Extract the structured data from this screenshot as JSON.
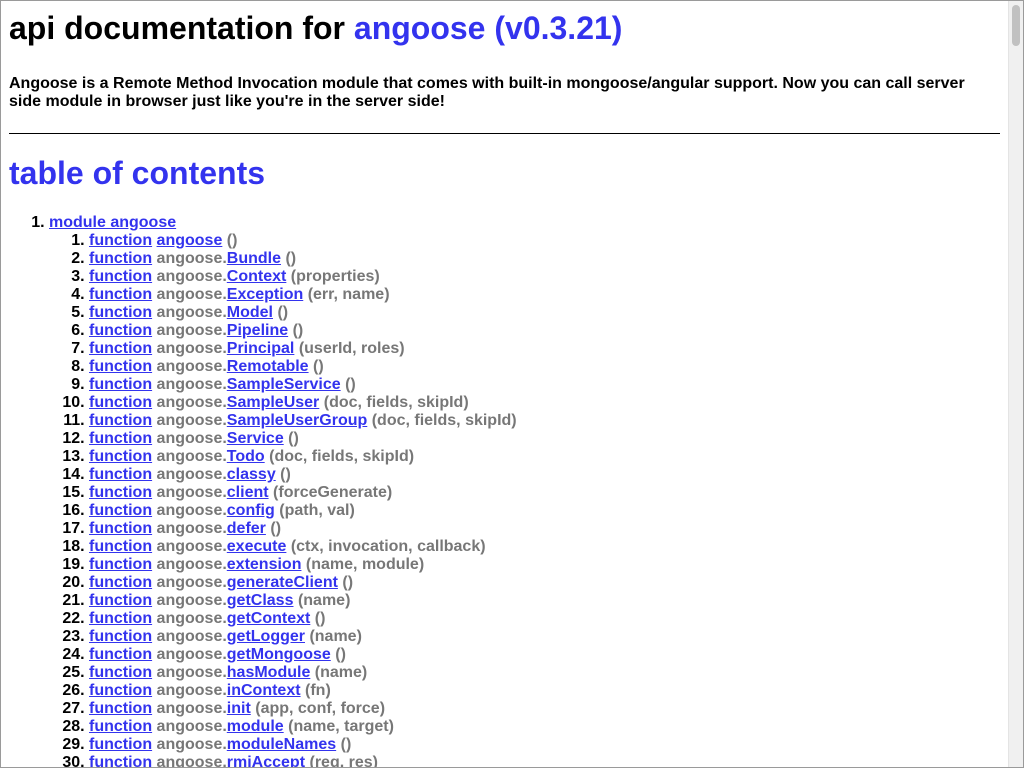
{
  "header": {
    "title_prefix": "api documentation for",
    "title_link": "angoose (v0.3.21)"
  },
  "description": "Angoose is a Remote Method Invocation module that comes with built-in mongoose/angular support. Now you can call server side module in browser just like you're in the server side!",
  "toc": {
    "heading": "table of contents",
    "module_label": "module angoose",
    "items": [
      {
        "keyword": "function",
        "namespace": "",
        "name": "angoose",
        "args": "()"
      },
      {
        "keyword": "function",
        "namespace": "angoose.",
        "name": "Bundle",
        "args": "()"
      },
      {
        "keyword": "function",
        "namespace": "angoose.",
        "name": "Context",
        "args": "(properties)"
      },
      {
        "keyword": "function",
        "namespace": "angoose.",
        "name": "Exception",
        "args": "(err, name)"
      },
      {
        "keyword": "function",
        "namespace": "angoose.",
        "name": "Model",
        "args": "()"
      },
      {
        "keyword": "function",
        "namespace": "angoose.",
        "name": "Pipeline",
        "args": "()"
      },
      {
        "keyword": "function",
        "namespace": "angoose.",
        "name": "Principal",
        "args": "(userId, roles)"
      },
      {
        "keyword": "function",
        "namespace": "angoose.",
        "name": "Remotable",
        "args": "()"
      },
      {
        "keyword": "function",
        "namespace": "angoose.",
        "name": "SampleService",
        "args": "()"
      },
      {
        "keyword": "function",
        "namespace": "angoose.",
        "name": "SampleUser",
        "args": "(doc, fields, skipId)"
      },
      {
        "keyword": "function",
        "namespace": "angoose.",
        "name": "SampleUserGroup",
        "args": "(doc, fields, skipId)"
      },
      {
        "keyword": "function",
        "namespace": "angoose.",
        "name": "Service",
        "args": "()"
      },
      {
        "keyword": "function",
        "namespace": "angoose.",
        "name": "Todo",
        "args": "(doc, fields, skipId)"
      },
      {
        "keyword": "function",
        "namespace": "angoose.",
        "name": "classy",
        "args": "()"
      },
      {
        "keyword": "function",
        "namespace": "angoose.",
        "name": "client",
        "args": "(forceGenerate)"
      },
      {
        "keyword": "function",
        "namespace": "angoose.",
        "name": "config",
        "args": "(path, val)"
      },
      {
        "keyword": "function",
        "namespace": "angoose.",
        "name": "defer",
        "args": "()"
      },
      {
        "keyword": "function",
        "namespace": "angoose.",
        "name": "execute",
        "args": "(ctx, invocation, callback)"
      },
      {
        "keyword": "function",
        "namespace": "angoose.",
        "name": "extension",
        "args": "(name, module)"
      },
      {
        "keyword": "function",
        "namespace": "angoose.",
        "name": "generateClient",
        "args": "()"
      },
      {
        "keyword": "function",
        "namespace": "angoose.",
        "name": "getClass",
        "args": "(name)"
      },
      {
        "keyword": "function",
        "namespace": "angoose.",
        "name": "getContext",
        "args": "()"
      },
      {
        "keyword": "function",
        "namespace": "angoose.",
        "name": "getLogger",
        "args": "(name)"
      },
      {
        "keyword": "function",
        "namespace": "angoose.",
        "name": "getMongoose",
        "args": "()"
      },
      {
        "keyword": "function",
        "namespace": "angoose.",
        "name": "hasModule",
        "args": "(name)"
      },
      {
        "keyword": "function",
        "namespace": "angoose.",
        "name": "inContext",
        "args": "(fn)"
      },
      {
        "keyword": "function",
        "namespace": "angoose.",
        "name": "init",
        "args": "(app, conf, force)"
      },
      {
        "keyword": "function",
        "namespace": "angoose.",
        "name": "module",
        "args": "(name, target)"
      },
      {
        "keyword": "function",
        "namespace": "angoose.",
        "name": "moduleNames",
        "args": "()"
      },
      {
        "keyword": "function",
        "namespace": "angoose.",
        "name": "rmiAccept",
        "args": "(req, res)"
      }
    ]
  },
  "colors": {
    "link": "#3333ee",
    "muted": "#777777",
    "text": "#000000"
  }
}
